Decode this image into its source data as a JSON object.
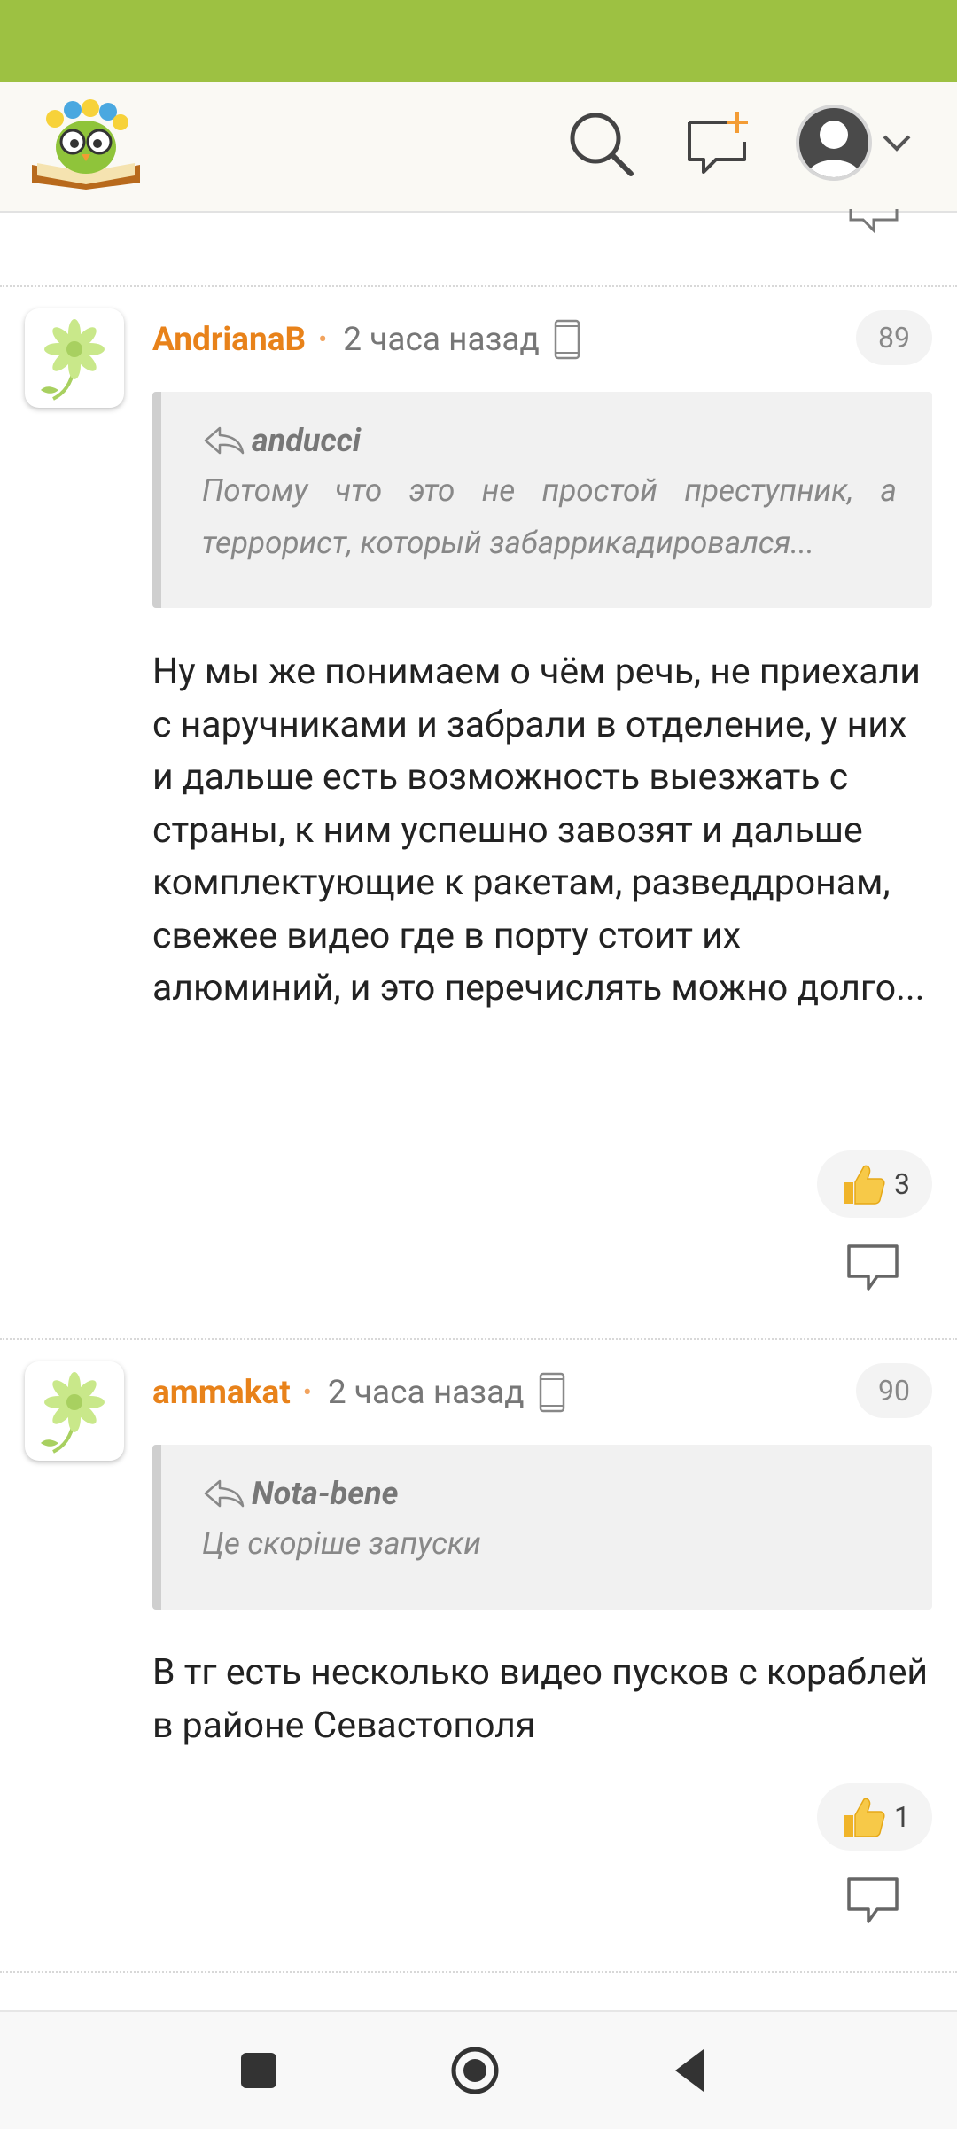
{
  "header": {
    "logo_icon": "owl-book-logo-icon",
    "search_icon": "search-icon",
    "new_post_icon": "new-message-icon",
    "profile_icon": "avatar-icon",
    "menu_icon": "chevron-down-icon"
  },
  "comments": [
    {
      "author": "AndrianaB",
      "time": "2 часа назад",
      "number": "89",
      "quote": {
        "author": "anducci",
        "text": "Потому что это не простой преступник, а террорист, который забаррикадировался..."
      },
      "text": "Ну мы же понимаем о чём речь, не приехали с наручниками и забрали в отделение, у них и дальше есть возможность выезжать с страны, к ним успешно завозят и дальше комплектующие к ракетам, разведдронам, свежее видео где в порту стоит их алюминий, и это перечислять можно долго...",
      "likes": "3"
    },
    {
      "author": "ammakat",
      "time": "2 часа назад",
      "number": "90",
      "quote": {
        "author": "Nota-bene",
        "text": "Це скоріше запуски"
      },
      "text": "В тг есть несколько видео пусков с кораблей в районе Севастополя",
      "likes": "1"
    }
  ],
  "colors": {
    "status_bar": "#9dc142",
    "author": "#e8821a",
    "accent_orange": "#f39c34"
  }
}
